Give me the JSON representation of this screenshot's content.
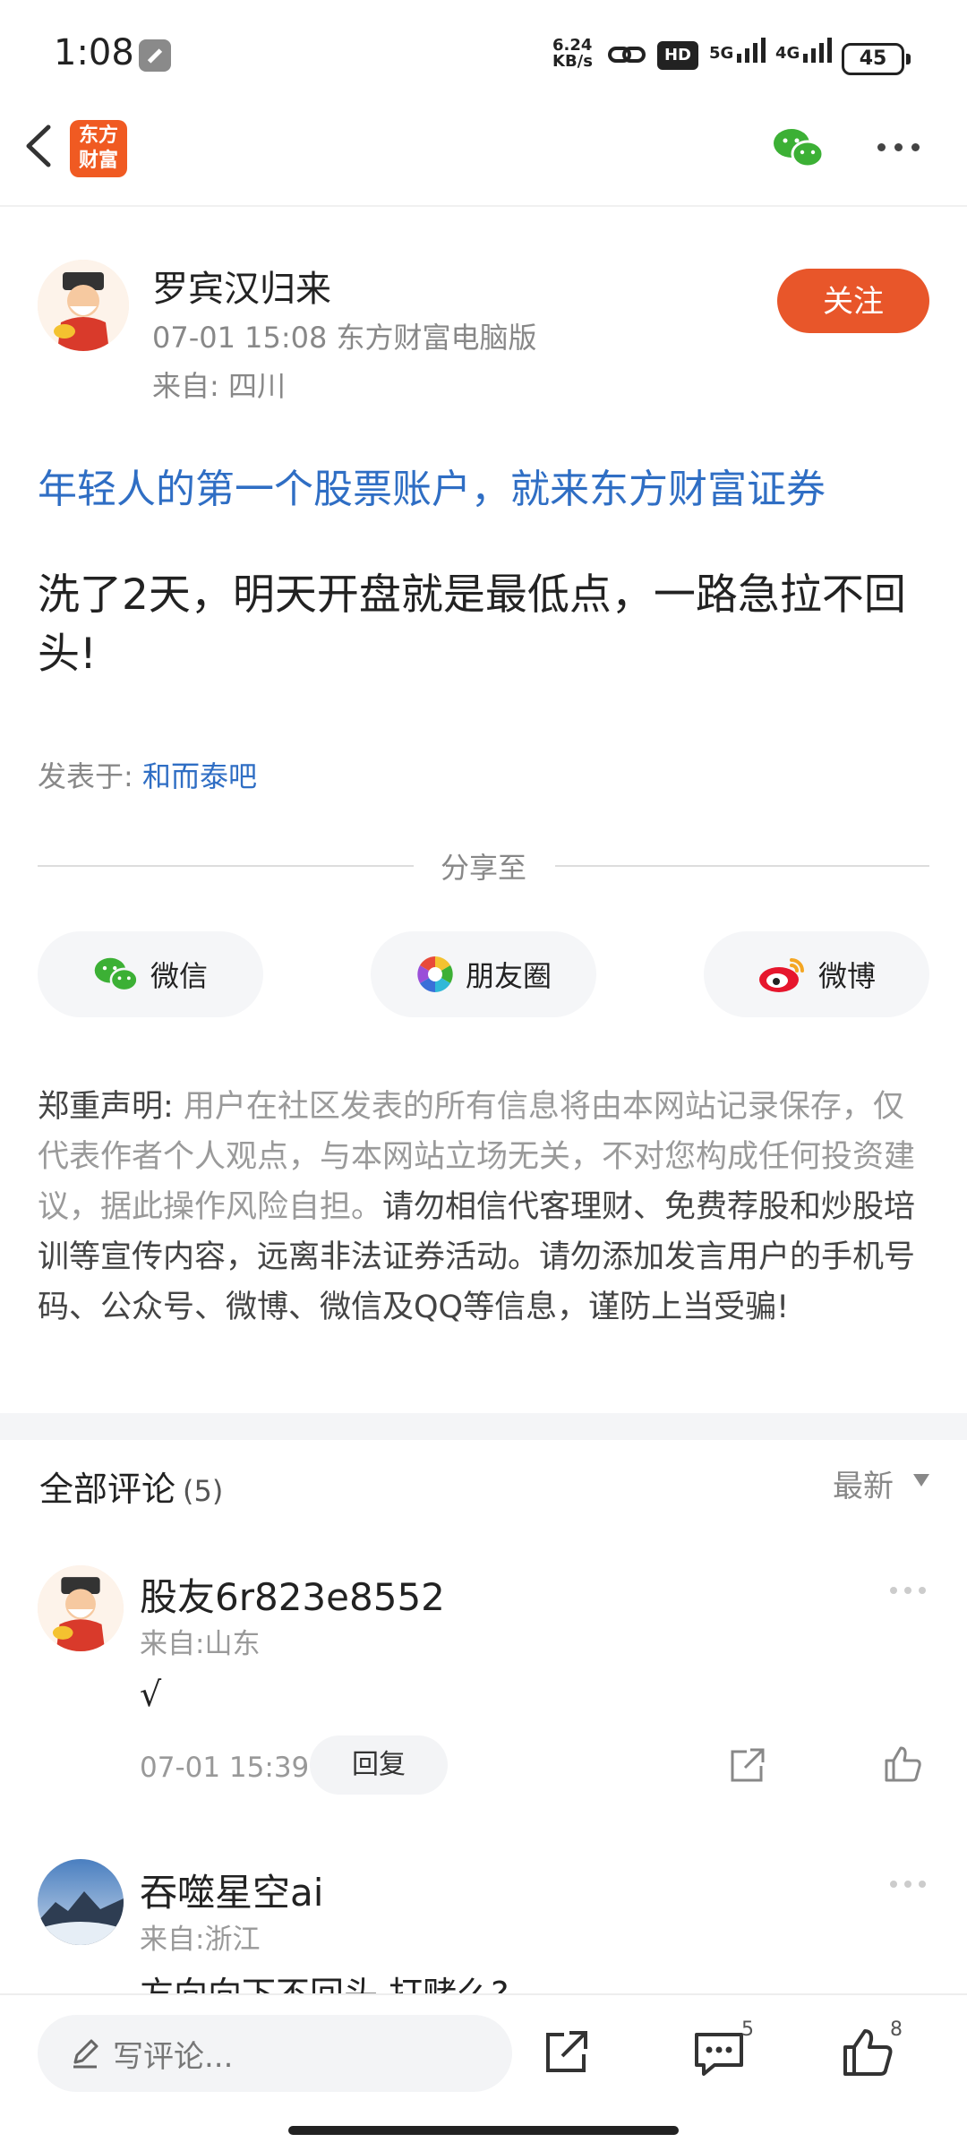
{
  "status": {
    "time": "1:08",
    "net_speed_value": "6.24",
    "net_speed_unit": "KB/s",
    "hd": "HD",
    "sim1": "5G",
    "sim2": "4G",
    "battery": "45"
  },
  "header": {
    "logo_text_line1": "东方",
    "logo_text_line2": "财富"
  },
  "author": {
    "name": "罗宾汉归来",
    "meta": "07-01 15:08 东方财富电脑版",
    "from": "来自: 四川",
    "follow_label": "关注"
  },
  "post": {
    "promo": "年轻人的第一个股票账户，就来东方财富证券",
    "body": "洗了2天，明天开盘就是最低点，一路急拉不回头!",
    "posted_in_label": "发表于: ",
    "bar_name": "和而泰吧"
  },
  "share": {
    "title": "分享至",
    "wechat": "微信",
    "moments": "朋友圈",
    "weibo": "微博"
  },
  "disclaimer": {
    "label": "郑重声明:",
    "grey_text": " 用户在社区发表的所有信息将由本网站记录保存，仅代表作者个人观点，与本网站立场无关，不对您构成任何投资建议，据此操作风险自担。",
    "dark_text": "请勿相信代客理财、免费荐股和炒股培训等宣传内容，远离非法证券活动。请勿添加发言用户的手机号码、公众号、微博、微信及QQ等信息，谨防上当受骗!"
  },
  "comments": {
    "title": "全部评论",
    "count": "(5)",
    "sort": "最新",
    "items": [
      {
        "name": "股友6r823e8552",
        "from": "来自:山东",
        "text": "√",
        "time": "07-01 15:39",
        "reply": "回复"
      },
      {
        "name": "吞噬星空ai",
        "from": "来自:浙江",
        "text": "方向向下不回头 打赌么?"
      }
    ]
  },
  "bottom": {
    "placeholder": "写评论...",
    "comment_count": "5",
    "like_count": "8"
  },
  "colors": {
    "accent": "#e8562a",
    "link": "#2f6ec4",
    "wechat_green": "#3cb035"
  }
}
